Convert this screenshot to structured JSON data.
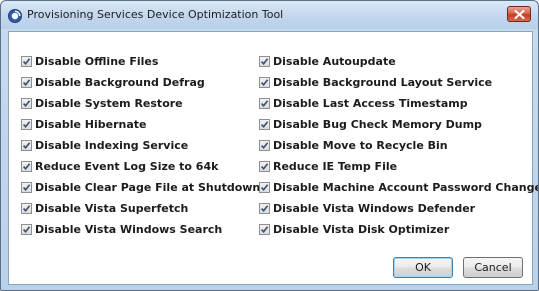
{
  "window": {
    "title": "Provisioning Services Device Optimization Tool",
    "close_label": "close"
  },
  "options": {
    "left": [
      {
        "label": "Disable Offline Files",
        "checked": true
      },
      {
        "label": "Disable Background Defrag",
        "checked": true
      },
      {
        "label": "Disable System Restore",
        "checked": true
      },
      {
        "label": "Disable Hibernate",
        "checked": true
      },
      {
        "label": "Disable Indexing Service",
        "checked": true
      },
      {
        "label": "Reduce Event Log Size to 64k",
        "checked": true
      },
      {
        "label": "Disable Clear Page File at Shutdown",
        "checked": true
      },
      {
        "label": "Disable Vista Superfetch",
        "checked": true
      },
      {
        "label": "Disable Vista Windows Search",
        "checked": true
      }
    ],
    "right": [
      {
        "label": "Disable Autoupdate",
        "checked": true
      },
      {
        "label": "Disable Background Layout Service",
        "checked": true
      },
      {
        "label": "Disable Last Access Timestamp",
        "checked": true
      },
      {
        "label": "Disable Bug Check Memory Dump",
        "checked": true
      },
      {
        "label": "Disable Move to Recycle Bin",
        "checked": true
      },
      {
        "label": "Reduce IE Temp File",
        "checked": true
      },
      {
        "label": "Disable Machine Account Password Changes",
        "checked": true
      },
      {
        "label": "Disable Vista Windows Defender",
        "checked": true
      },
      {
        "label": "Disable Vista Disk Optimizer",
        "checked": true
      }
    ]
  },
  "buttons": {
    "ok_label": "OK",
    "cancel_label": "Cancel"
  },
  "icons": {
    "app": "app-icon",
    "close": "close-icon",
    "check": "checkmark-icon"
  },
  "colors": {
    "frame": "#b9d1ea",
    "close_button": "#c8462f",
    "checkmark": "#3a4e6e"
  }
}
